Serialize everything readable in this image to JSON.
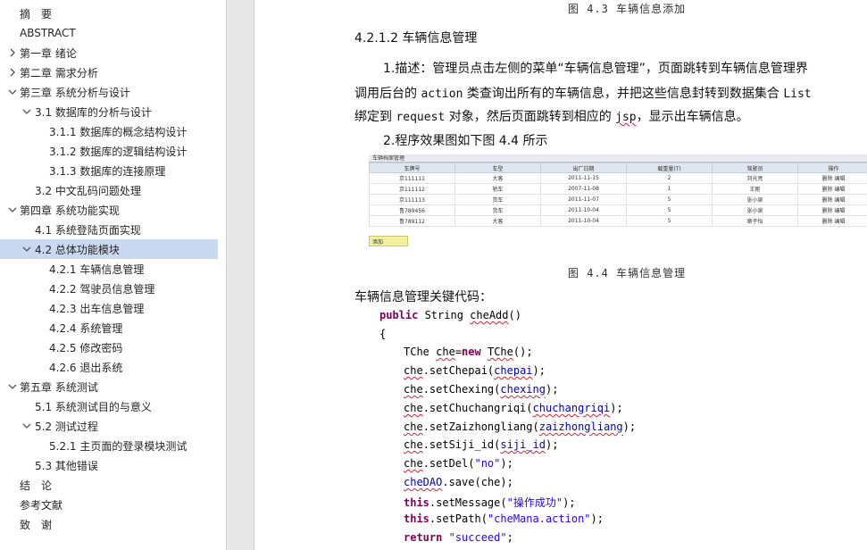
{
  "nav": {
    "items": [
      {
        "label": "摘　要",
        "level": 0,
        "expandable": false
      },
      {
        "label": "ABSTRACT",
        "level": 0,
        "expandable": false
      },
      {
        "label": "第一章 绪论",
        "level": 0,
        "expandable": true,
        "expanded": false
      },
      {
        "label": "第二章 需求分析",
        "level": 0,
        "expandable": true,
        "expanded": false
      },
      {
        "label": "第三章 系统分析与设计",
        "level": 0,
        "expandable": true,
        "expanded": true
      },
      {
        "label": "3.1 数据库的分析与设计",
        "level": 1,
        "expandable": true,
        "expanded": true
      },
      {
        "label": "3.1.1 数据库的概念结构设计",
        "level": 2,
        "expandable": false
      },
      {
        "label": "3.1.2 数据库的逻辑结构设计",
        "level": 2,
        "expandable": false
      },
      {
        "label": "3.1.3 数据库的连接原理",
        "level": 2,
        "expandable": false
      },
      {
        "label": "3.2 中文乱码问题处理",
        "level": 1,
        "expandable": false
      },
      {
        "label": "第四章 系统功能实现",
        "level": 0,
        "expandable": true,
        "expanded": true
      },
      {
        "label": "4.1 系统登陆页面实现",
        "level": 1,
        "expandable": false
      },
      {
        "label": "4.2 总体功能模块",
        "level": 1,
        "expandable": true,
        "expanded": true,
        "selected": true
      },
      {
        "label": "4.2.1 车辆信息管理",
        "level": 2,
        "expandable": false
      },
      {
        "label": "4.2.2 驾驶员信息管理",
        "level": 2,
        "expandable": false
      },
      {
        "label": "4.2.3 出车信息管理",
        "level": 2,
        "expandable": false
      },
      {
        "label": "4.2.4 系统管理",
        "level": 2,
        "expandable": false
      },
      {
        "label": "4.2.5 修改密码",
        "level": 2,
        "expandable": false
      },
      {
        "label": "4.2.6 退出系统",
        "level": 2,
        "expandable": false
      },
      {
        "label": "第五章 系统测试",
        "level": 0,
        "expandable": true,
        "expanded": true
      },
      {
        "label": "5.1 系统测试目的与意义",
        "level": 1,
        "expandable": false
      },
      {
        "label": "5.2 测试过程",
        "level": 1,
        "expandable": true,
        "expanded": true
      },
      {
        "label": "5.2.1 主页面的登录模块测试",
        "level": 2,
        "expandable": false
      },
      {
        "label": "5.3 其他错误",
        "level": 1,
        "expandable": false
      },
      {
        "label": "结　论",
        "level": 0,
        "expandable": false
      },
      {
        "label": "参考文献",
        "level": 0,
        "expandable": false
      },
      {
        "label": "致　谢",
        "level": 0,
        "expandable": false
      }
    ]
  },
  "doc": {
    "caption_top": "图 4.3 车辆信息添加",
    "section_heading": "4.2.1.2 车辆信息管理",
    "para1_line1": "1.描述：管理员点击左侧的菜单“车辆信息管理”，页面跳转到车辆信息管理界",
    "para1_line2_a": "调用后台的 ",
    "para1_line2_b": "action",
    "para1_line2_c": " 类查询出所有的车辆信息，并把这些信息封转到数据集合 ",
    "para1_line2_d": "List",
    "para1_line3_a": "绑定到 ",
    "para1_line3_b": "request",
    "para1_line3_c": " 对象，然后页面跳转到相应的 ",
    "para1_line3_d": "jsp",
    "para1_line3_e": "，显示出车辆信息。",
    "para2": "2.程序效果图如下图 4.4 所示",
    "figure": {
      "title": "车辆档案管理",
      "columns": [
        "车牌号",
        "车型",
        "出厂日期",
        "载重量(T)",
        "驾驶员",
        "操作"
      ],
      "rows": [
        [
          "京111111",
          "大客",
          "2011-11-15",
          "2",
          "刘光亮",
          "删除 编辑"
        ],
        [
          "京111112",
          "轿车",
          "2007-11-08",
          "1",
          "王刚",
          "删除 编辑"
        ],
        [
          "京111113",
          "货车",
          "2011-11-07",
          "5",
          "张小泉",
          "删除 编辑"
        ],
        [
          "鲁789456",
          "货车",
          "2011-10-04",
          "5",
          "张小泉",
          "删除 编辑"
        ],
        [
          "鲁789112",
          "大客",
          "2011-10-04",
          "5",
          "章子怡",
          "删除 编辑"
        ]
      ],
      "add_button": "添加"
    },
    "caption_fig": "图 4.4 车辆信息管理",
    "code_intro": "车辆信息管理关键代码：",
    "code": {
      "l1_kw": "public",
      "l1_rest": " String ",
      "l1_name": "cheAdd",
      "l1_paren": "()",
      "l2": "{",
      "l3_a": "TChe ",
      "l3_b": "che",
      "l3_c": "=",
      "l3_kw": "new",
      "l3_d": " ",
      "l3_e": "TChe",
      "l3_f": "();",
      "l4_obj": "che",
      "l4_m": ".setChepai(",
      "l4_arg": "chepai",
      "l4_end": ");",
      "l5_obj": "che",
      "l5_m": ".setChexing(",
      "l5_arg": "chexing",
      "l5_end": ");",
      "l6_obj": "che",
      "l6_m": ".setChuchangriqi(",
      "l6_arg": "chuchangriqi",
      "l6_end": ");",
      "l7_obj": "che",
      "l7_m": ".setZaizhongliang(",
      "l7_arg": "zaizhongliang",
      "l7_end": ");",
      "l8_obj": "che",
      "l8_m": ".setSiji_id(",
      "l8_arg": "siji_id",
      "l8_end": ");",
      "l9_obj": "che",
      "l9_m": ".setDel(",
      "l9_arg": "\"no\"",
      "l9_end": ");",
      "l10_obj": "cheDAO",
      "l10_m": ".save(",
      "l10_arg": "che",
      "l10_end": ");",
      "l11_kw": "this",
      "l11_m": ".setMessage(",
      "l11_arg": "\"操作成功\"",
      "l11_end": ");",
      "l12_kw": "this",
      "l12_m": ".setPath(",
      "l12_arg": "\"cheMana.action\"",
      "l12_end": ");",
      "l13_kw": "return",
      "l13_sp": " ",
      "l13_arg": "\"succeed\"",
      "l13_end": ";"
    }
  }
}
